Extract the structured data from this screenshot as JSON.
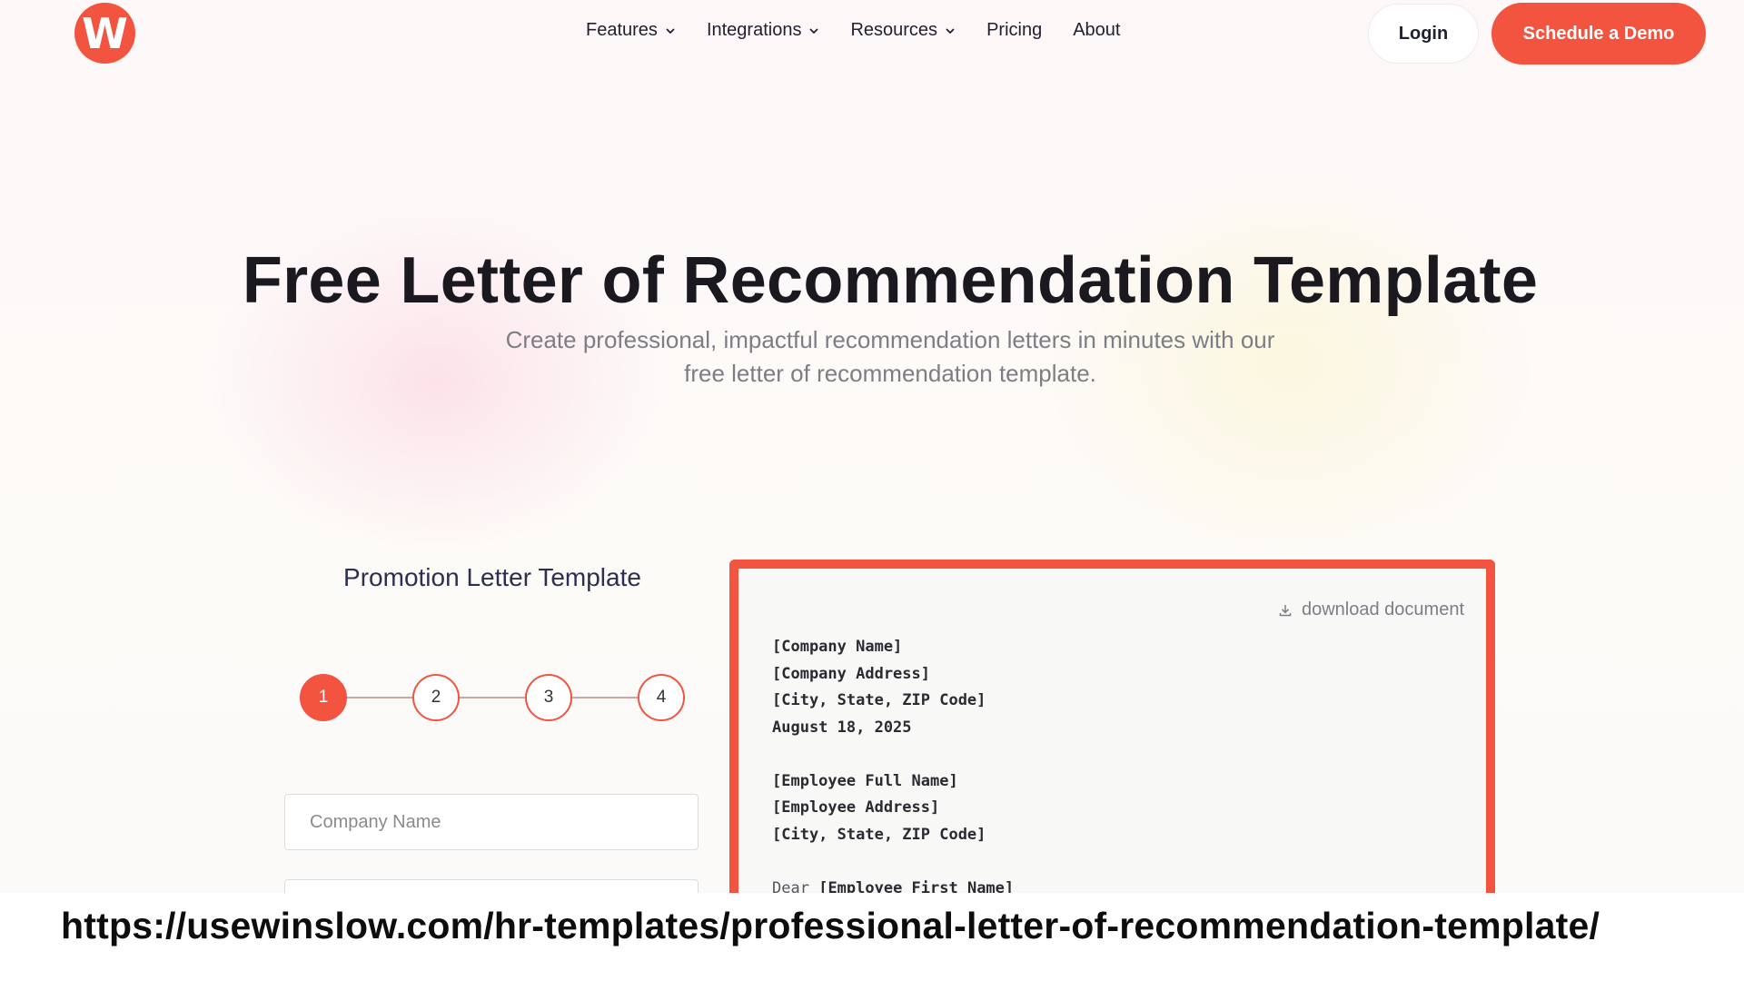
{
  "nav": {
    "logo_letter": "W",
    "items": [
      {
        "label": "Features",
        "has_dropdown": true
      },
      {
        "label": "Integrations",
        "has_dropdown": true
      },
      {
        "label": "Resources",
        "has_dropdown": true
      },
      {
        "label": "Pricing",
        "has_dropdown": false
      },
      {
        "label": "About",
        "has_dropdown": false
      }
    ],
    "login_label": "Login",
    "demo_label": "Schedule a Demo"
  },
  "hero": {
    "title": "Free Letter of Recommendation Template",
    "subtitle_line1": "Create professional, impactful recommendation letters in minutes with our",
    "subtitle_line2": "free letter of recommendation template."
  },
  "form": {
    "title": "Promotion Letter Template",
    "steps": [
      "1",
      "2",
      "3",
      "4"
    ],
    "active_step": 1,
    "company_name_placeholder": "Company Name"
  },
  "preview": {
    "download_label": "download document",
    "lines": {
      "company_name": "[Company Name]",
      "company_address": "[Company Address]",
      "company_city": "[City, State, ZIP Code]",
      "date": "August 18, 2025",
      "employee_name": "[Employee Full Name]",
      "employee_address": "[Employee Address]",
      "employee_city": "[City, State, ZIP Code]",
      "salutation": "Dear",
      "employee_first_name": "[Employee First Name]"
    }
  },
  "footer": {
    "url": "https://usewinslow.com/hr-templates/professional-letter-of-recommendation-template/"
  },
  "colors": {
    "brand": "#f25440",
    "text_dark": "#1a1920",
    "text_muted": "#7d7d86"
  }
}
